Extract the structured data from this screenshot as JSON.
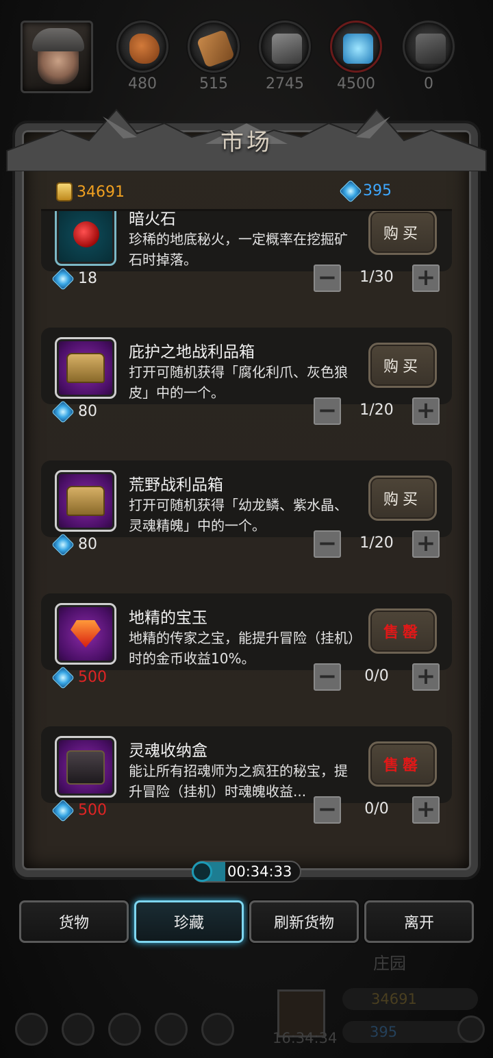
{
  "resources": [
    {
      "name": "meat",
      "value": "480"
    },
    {
      "name": "wood",
      "value": "515"
    },
    {
      "name": "iron",
      "value": "2745"
    },
    {
      "name": "crystal",
      "value": "4500"
    },
    {
      "name": "ore",
      "value": "0"
    }
  ],
  "market": {
    "title": "市场",
    "gold": "34691",
    "gems": "395",
    "items": [
      {
        "name": "暗火石",
        "desc": "珍稀的地底秘火，一定概率在挖掘矿石时掉落。",
        "button": "购买",
        "price": "18",
        "qty": "1/30",
        "sold_out": false,
        "icon": "fire-stone"
      },
      {
        "name": "庇护之地战利品箱",
        "desc": "打开可随机获得「腐化利爪、灰色狼皮」中的一个。",
        "button": "购买",
        "price": "80",
        "qty": "1/20",
        "sold_out": false,
        "icon": "loot-chest"
      },
      {
        "name": "荒野战利品箱",
        "desc": "打开可随机获得「幼龙鳞、紫水晶、灵魂精魄」中的一个。",
        "button": "购买",
        "price": "80",
        "qty": "1/20",
        "sold_out": false,
        "icon": "loot-chest"
      },
      {
        "name": "地精的宝玉",
        "desc": "地精的传家之宝，能提升冒险（挂机）时的金币收益10%。",
        "button": "售罄",
        "price": "500",
        "qty": "0/0",
        "sold_out": true,
        "icon": "red-gem"
      },
      {
        "name": "灵魂收纳盒",
        "desc": "能让所有招魂师为之疯狂的秘宝，提升冒险（挂机）时魂魄收益...",
        "button": "售罄",
        "price": "500",
        "qty": "0/0",
        "sold_out": true,
        "icon": "soul-box"
      }
    ],
    "stepper_minus": "−",
    "stepper_plus": "+"
  },
  "timer": "00:34:33",
  "nav": {
    "goods": "货物",
    "treasures": "珍藏",
    "refresh": "刷新货物",
    "leave": "离开"
  },
  "background": {
    "manor_label": "庄园",
    "gold": "34691",
    "gems": "395",
    "clock": "16:34:34"
  },
  "colors": {
    "sold_out_text": "#e01818",
    "price_red": "#e02424",
    "gold_text": "#f0a020",
    "gem_text": "#3fa8ff",
    "active_tab_glow": "#7ed6f0"
  }
}
